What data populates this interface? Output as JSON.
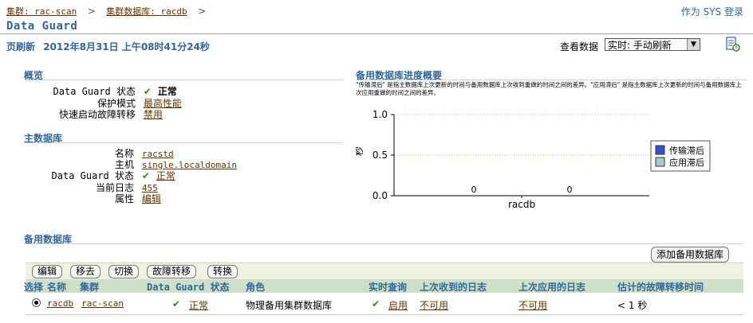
{
  "header": {
    "breadcrumb": [
      {
        "label": "集群: rac-scan"
      },
      {
        "label": "集群数据库: racdb"
      }
    ],
    "separator": ">",
    "login_status": "作为 SYS 登录",
    "page_title": "Data Guard",
    "refresh_label": "页刷新",
    "refresh_time": "2012年8月31日 上午08时41分24秒",
    "view_data_label": "查看数据",
    "view_data_value": "实时: 手动刷新"
  },
  "overview": {
    "title": "概览",
    "status_label": "Data Guard 状态",
    "status_value": "正常",
    "protection_label": "保护模式",
    "protection_value": "最高性能",
    "fsfo_label": "快速启动故障转移",
    "fsfo_value": "禁用"
  },
  "primary": {
    "title": "主数据库",
    "name_label": "名称",
    "name_value": "racstd",
    "host_label": "主机",
    "host_value": "single.localdomain",
    "status_label": "Data Guard 状态",
    "status_value": "正常",
    "log_label": "当前日志",
    "log_value": "455",
    "props_label": "属性",
    "props_value": "编辑"
  },
  "progress": {
    "title": "备用数据库进度概要",
    "description": "\"传输滞后\" 是指主数据库上次更新的时间与备用数据库上次收到重做的时间之间的差异。\"应用滞后\" 是指主数据库上次更新的时间与备用数据库上次应用重做的时间之间的差异。"
  },
  "chart_data": {
    "type": "bar",
    "categories": [
      "racdb"
    ],
    "series": [
      {
        "name": "传输滞后",
        "values": [
          0
        ],
        "color": "#3355cc"
      },
      {
        "name": "应用滞后",
        "values": [
          0
        ],
        "color": "#a8cccc"
      }
    ],
    "ylabel": "秒",
    "ylim": [
      0.0,
      1.0
    ],
    "yticks": [
      "0.0",
      "0.5",
      "1.0"
    ],
    "data_labels": [
      "0",
      "0"
    ],
    "grid": true,
    "legend_position": "right"
  },
  "standby": {
    "title": "备用数据库",
    "add_button": "添加备用数据库",
    "buttons": [
      "编辑",
      "移去",
      "切换",
      "故障转移",
      "转换"
    ],
    "columns": [
      "选择",
      "名称",
      "集群",
      "Data Guard 状态",
      "角色",
      "实时查询",
      "上次收到的日志",
      "上次应用的日志",
      "估计的故障转移时间"
    ],
    "rows": [
      {
        "name": "racdb",
        "cluster": "rac-scan",
        "status": "正常",
        "role": "物理备用集群数据库",
        "realtime_query": "启用",
        "last_received": "不可用",
        "last_applied": "不可用",
        "failover_time": "< 1 秒"
      }
    ]
  }
}
